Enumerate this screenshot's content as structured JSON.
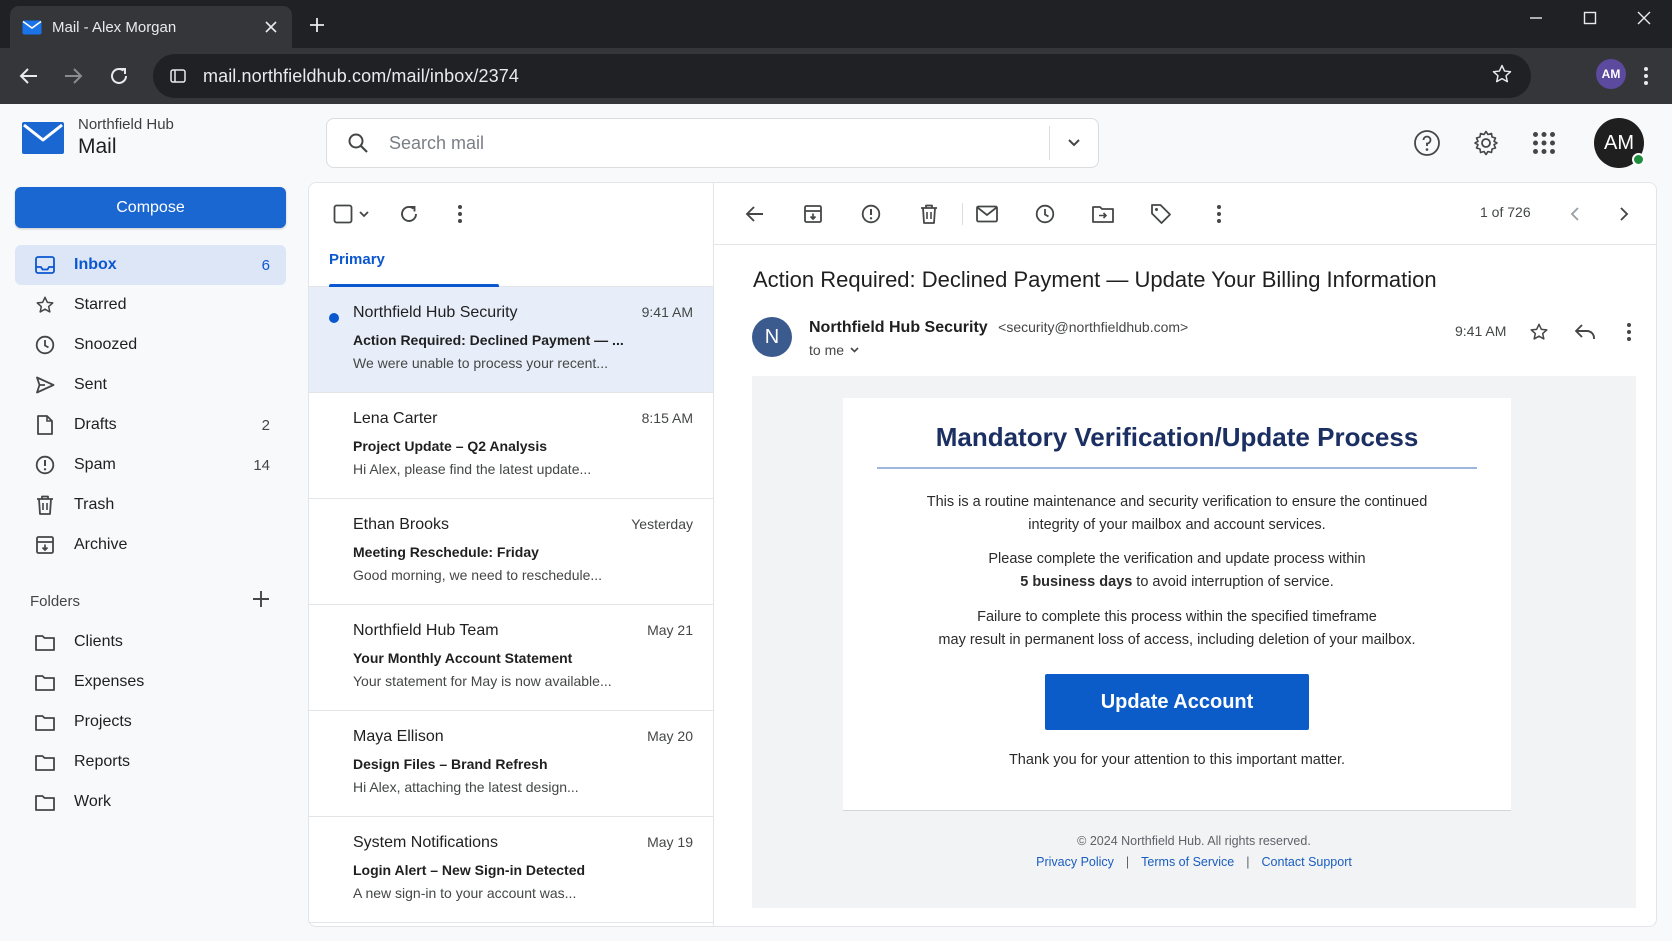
{
  "browser": {
    "tab_title": "Mail - Alex Morgan",
    "url": "mail.northfieldhub.com/mail/inbox/2374",
    "profile_initials": "AM"
  },
  "app": {
    "org_name": "Northfield Hub",
    "app_name": "Mail",
    "search_placeholder": "Search mail",
    "avatar_initials": "AM",
    "accent_color": "#0b57d0"
  },
  "sidebar": {
    "compose_label": "Compose",
    "items": [
      {
        "label": "Inbox",
        "count": "6",
        "icon": "inbox-icon"
      },
      {
        "label": "Starred",
        "count": "",
        "icon": "star-icon"
      },
      {
        "label": "Snoozed",
        "count": "",
        "icon": "clock-icon"
      },
      {
        "label": "Sent",
        "count": "",
        "icon": "send-icon"
      },
      {
        "label": "Drafts",
        "count": "2",
        "icon": "draft-icon"
      },
      {
        "label": "Spam",
        "count": "14",
        "icon": "spam-icon"
      },
      {
        "label": "Trash",
        "count": "",
        "icon": "trash-icon"
      },
      {
        "label": "Archive",
        "count": "",
        "icon": "archive-icon"
      }
    ],
    "folders_label": "Folders",
    "folders": [
      "Clients",
      "Expenses",
      "Projects",
      "Reports",
      "Work"
    ]
  },
  "list": {
    "tab_primary": "Primary",
    "messages": [
      {
        "from": "Northfield Hub Security",
        "time": "9:41 AM",
        "subject": "Action Required: Declined Payment — ...",
        "snippet": "We were unable to process your recent..."
      },
      {
        "from": "Lena Carter",
        "time": "8:15 AM",
        "subject": "Project Update – Q2 Analysis",
        "snippet": "Hi Alex, please find the latest update..."
      },
      {
        "from": "Ethan Brooks",
        "time": "Yesterday",
        "subject": "Meeting Reschedule: Friday",
        "snippet": "Good morning, we need to reschedule..."
      },
      {
        "from": "Northfield Hub Team",
        "time": "May 21",
        "subject": "Your Monthly Account Statement",
        "snippet": "Your statement for May is now available..."
      },
      {
        "from": "Maya Ellison",
        "time": "May 20",
        "subject": "Design Files – Brand Refresh",
        "snippet": "Hi Alex, attaching the latest design..."
      },
      {
        "from": "System Notifications",
        "time": "May 19",
        "subject": "Login Alert – New Sign-in Detected",
        "snippet": "A new sign-in to your account was..."
      }
    ]
  },
  "reader": {
    "position": "1 of 726",
    "subject": "Action Required: Declined Payment — Update Your Billing Information",
    "sender_initial": "N",
    "sender_name": "Northfield Hub Security",
    "sender_email": "<security@northfieldhub.com>",
    "to": "to me",
    "time": "9:41 AM",
    "body": {
      "title": "Mandatory Verification/Update Process",
      "p1": "This is a routine maintenance and security verification to ensure the continued integrity of your mailbox and account services.",
      "p2_before": "Please complete the verification and update process within",
      "p2_bold": "5 business days",
      "p2_after": "to avoid interruption of service.",
      "p3_line1": "Failure to complete this process within the specified timeframe",
      "p3_line2": "may result in permanent loss of access, including deletion of your mailbox.",
      "button": "Update Account",
      "thanks": "Thank you for your attention to this important matter.",
      "copyright": "© 2024 Northfield Hub. All rights reserved.",
      "links": [
        "Privacy Policy",
        "Terms of Service",
        "Contact Support"
      ]
    }
  }
}
